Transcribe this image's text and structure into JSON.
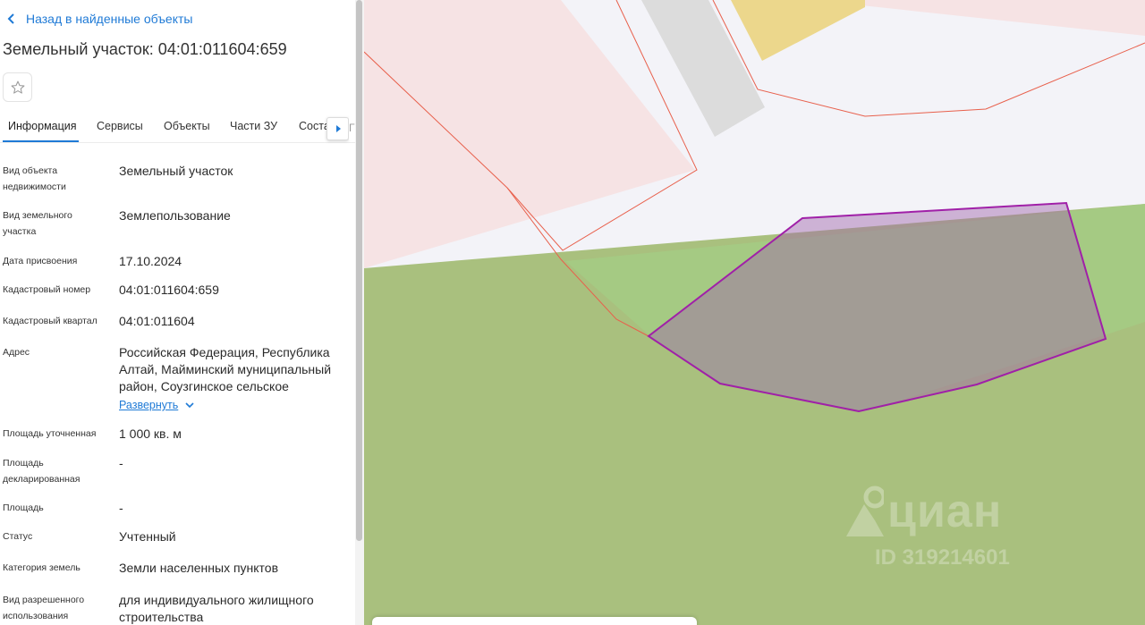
{
  "nav": {
    "back_label": "Назад в найденные объекты"
  },
  "title": "Земельный участок: 04:01:011604:659",
  "tabs": [
    {
      "label": "Информация",
      "active": true
    },
    {
      "label": "Сервисы"
    },
    {
      "label": "Объекты"
    },
    {
      "label": "Части ЗУ"
    },
    {
      "label": "Соста"
    }
  ],
  "tab_overflow_char": "Г",
  "info": {
    "object_type_label": "Вид объекта недвижимости",
    "object_type_value": "Земельный участок",
    "land_type_label": "Вид земельного участка",
    "land_type_value": "Землепользование",
    "assign_date_label": "Дата присвоения",
    "assign_date_value": "17.10.2024",
    "cad_number_label": "Кадастровый номер",
    "cad_number_value": "04:01:011604:659",
    "cad_quarter_label": "Кадастровый квартал",
    "cad_quarter_value": "04:01:011604",
    "address_label": "Адрес",
    "address_value": "Российская Федерация, Республика Алтай, Майминский муниципальный район, Соузгинское сельское",
    "expand_label": "Развернуть",
    "area_precise_label": "Площадь уточненная",
    "area_precise_value": "1 000 кв. м",
    "area_declared_label": "Площадь декларированная",
    "area_declared_value": "-",
    "area_label": "Площадь",
    "area_value": "-",
    "status_label": "Статус",
    "status_value": "Учтенный",
    "land_category_label": "Категория земель",
    "land_category_value": "Земли населенных пунктов",
    "permitted_use_label": "Вид разрешенного использования",
    "permitted_use_value": "для индивидуального жилищного строительства"
  },
  "watermark": {
    "brand": "циан",
    "id": "ID 319214601"
  },
  "colors": {
    "link": "#1f7ad6",
    "parcel_outline": "#a020a8",
    "neighbor_outline": "#e8604c",
    "field_green": "#a9bf7e"
  }
}
